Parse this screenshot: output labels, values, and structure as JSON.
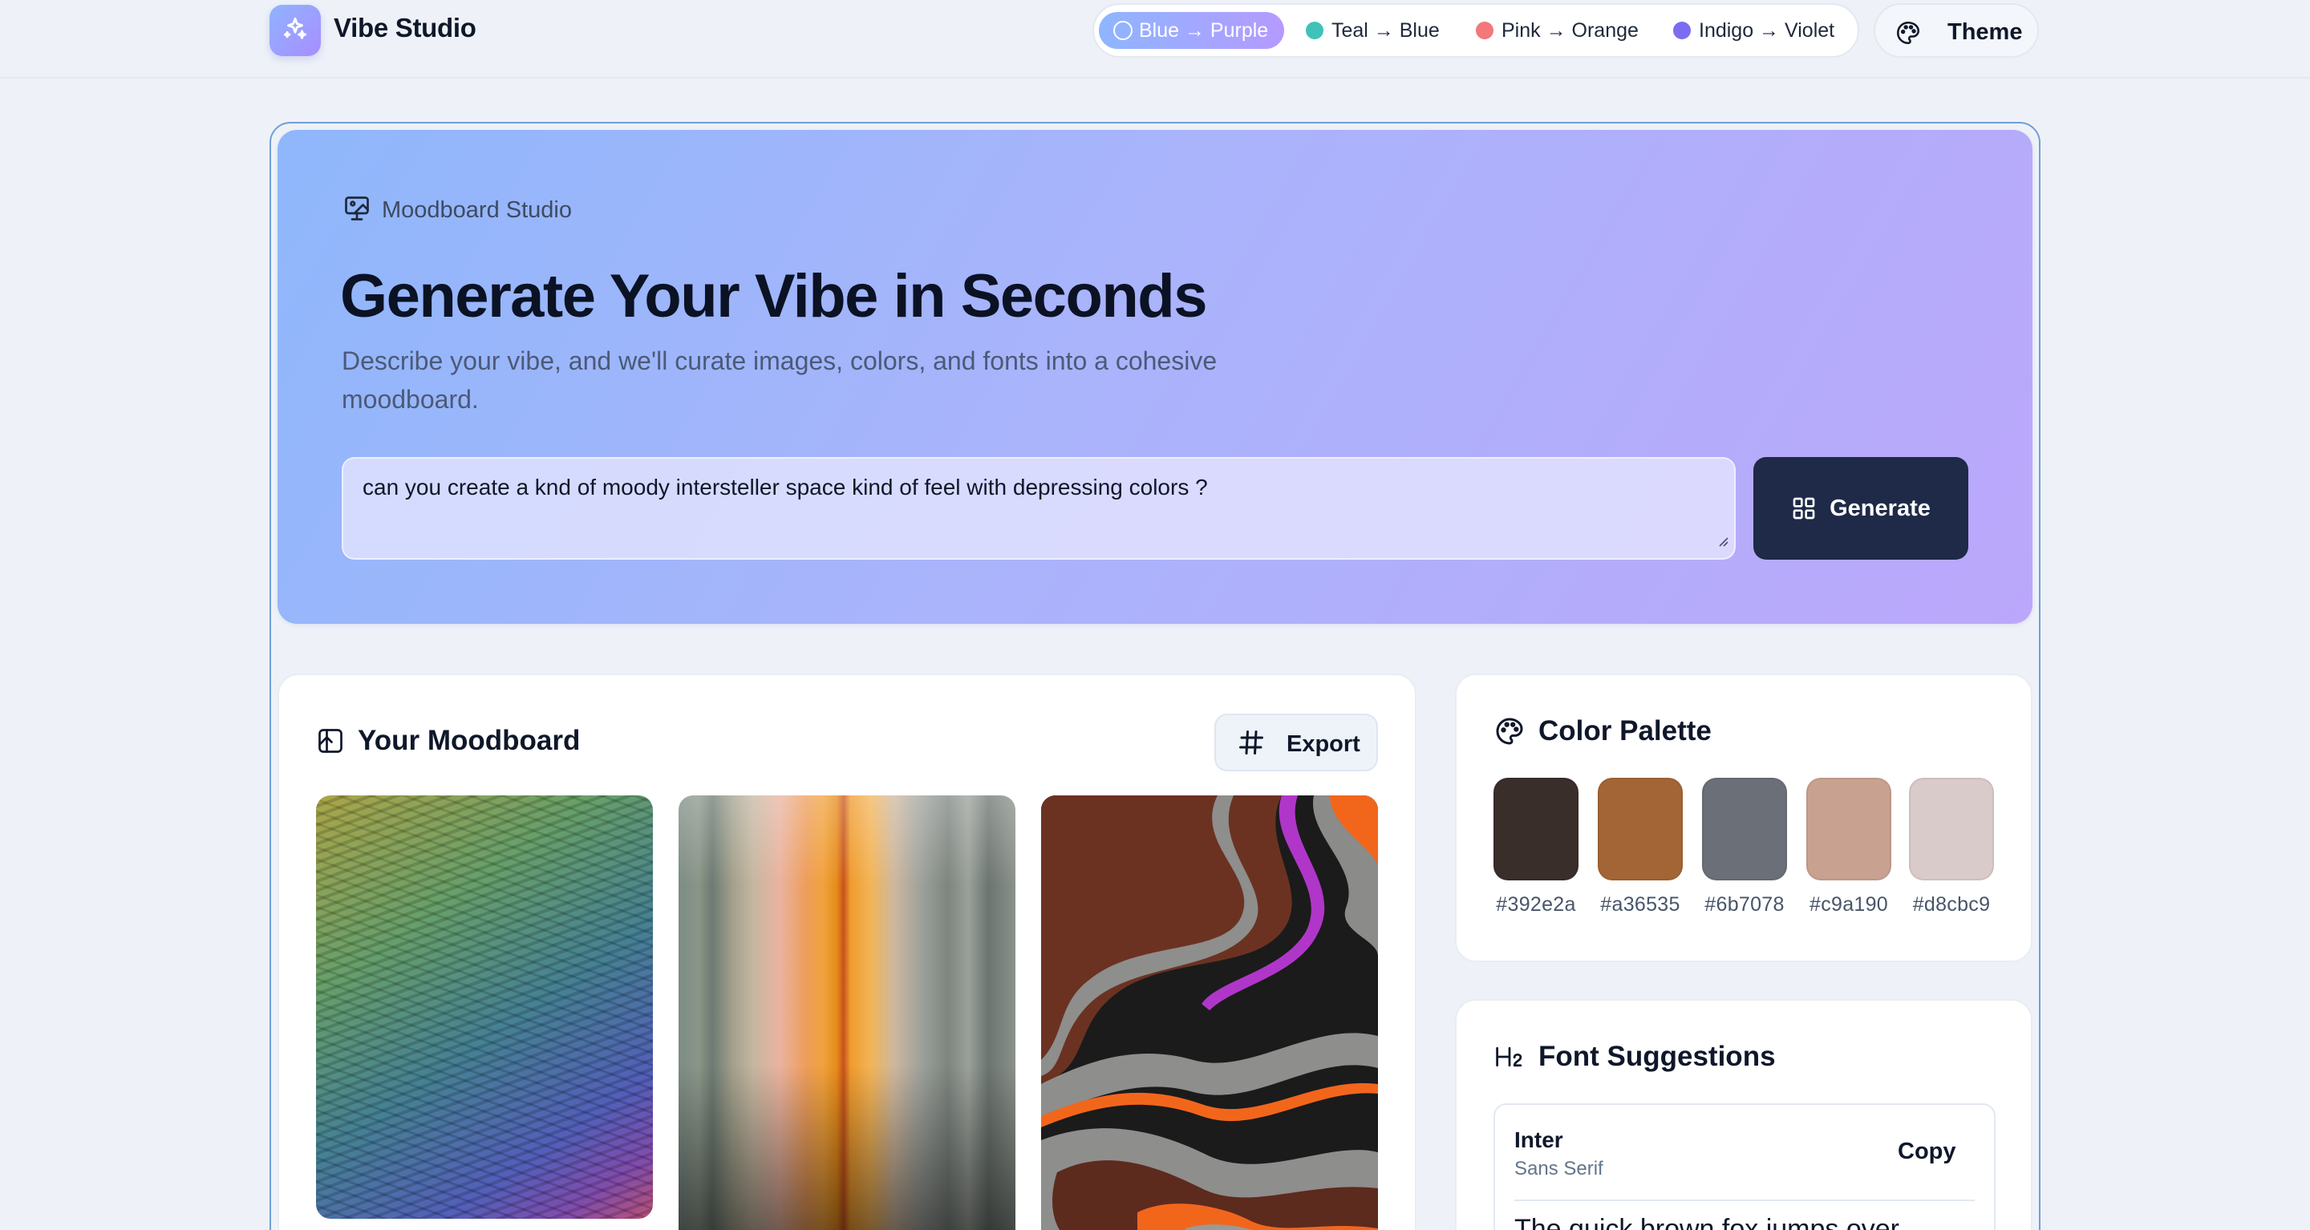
{
  "app": {
    "name": "Vibe Studio"
  },
  "nav": {
    "gradients": [
      {
        "label": "Blue → Purple",
        "color": "#8eb6ff",
        "active": true
      },
      {
        "label": "Teal → Blue",
        "color": "#3fc2b8",
        "active": false
      },
      {
        "label": "Pink → Orange",
        "color": "#f2787a",
        "active": false
      },
      {
        "label": "Indigo → Violet",
        "color": "#7c6cf0",
        "active": false
      }
    ],
    "theme_label": "Theme"
  },
  "hero": {
    "eyebrow": "Moodboard Studio",
    "title": "Generate Your Vibe in Seconds",
    "subtitle": "Describe your vibe, and we'll curate images, colors, and fonts into a cohesive moodboard.",
    "prompt_value": "can you create a knd of moody intersteller space kind of feel with depressing colors ?",
    "generate_label": "Generate"
  },
  "moodboard": {
    "title": "Your Moodboard",
    "export_label": "Export"
  },
  "palette": {
    "title": "Color Palette",
    "colors": [
      {
        "hex": "#392e2a",
        "label": "#392e2a"
      },
      {
        "hex": "#a36535",
        "label": "#a36535"
      },
      {
        "hex": "#6b7078",
        "label": "#6b7078"
      },
      {
        "hex": "#c9a190",
        "label": "#c9a190"
      },
      {
        "hex": "#d8cbc9",
        "label": "#d8cbc9"
      }
    ]
  },
  "fonts": {
    "title": "Font Suggestions",
    "items": [
      {
        "name": "Inter",
        "category": "Sans Serif",
        "copy_label": "Copy",
        "sample": "The quick brown fox jumps over"
      }
    ]
  }
}
